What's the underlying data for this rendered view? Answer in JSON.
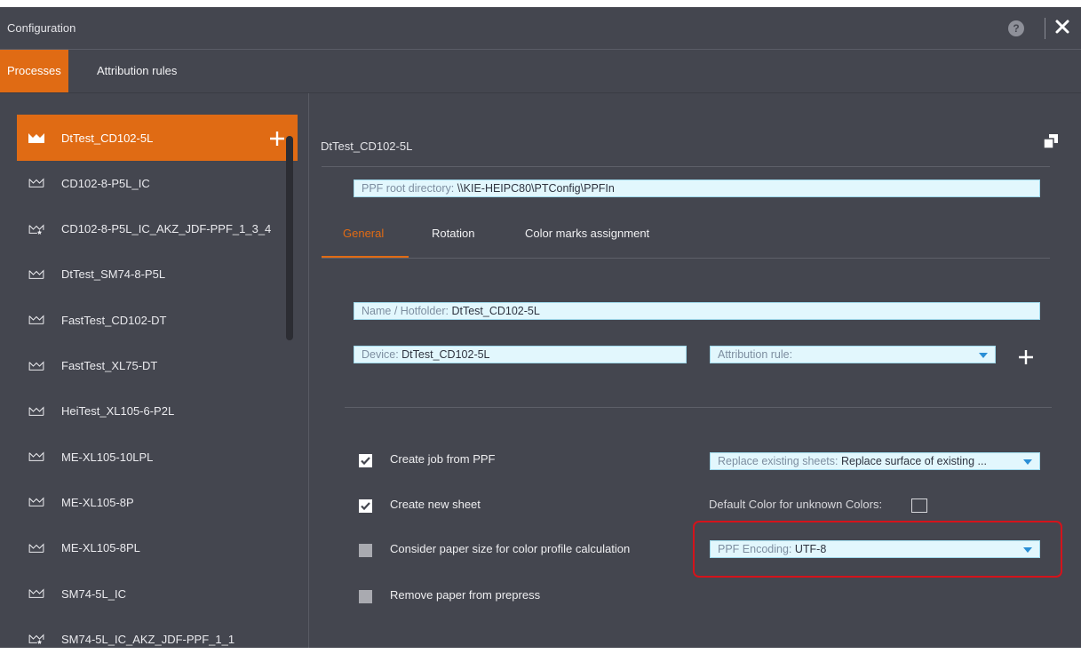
{
  "window": {
    "title": "Configuration"
  },
  "top_tabs": [
    {
      "label": "Processes",
      "active": true
    },
    {
      "label": "Attribution rules",
      "active": false
    }
  ],
  "processes": [
    {
      "label": "DtTest_CD102-5L",
      "active": true,
      "icon": "crown-icon"
    },
    {
      "label": "CD102-8-P5L_IC",
      "icon": "crown-outline-icon"
    },
    {
      "label": "CD102-8-P5L_IC_AKZ_JDF-PPF_1_3_4",
      "icon": "crown-star-icon"
    },
    {
      "label": "DtTest_SM74-8-P5L",
      "icon": "crown-outline-icon"
    },
    {
      "label": "FastTest_CD102-DT",
      "icon": "crown-outline-icon"
    },
    {
      "label": "FastTest_XL75-DT",
      "icon": "crown-outline-icon"
    },
    {
      "label": "HeiTest_XL105-6-P2L",
      "icon": "crown-outline-icon"
    },
    {
      "label": "ME-XL105-10LPL",
      "icon": "crown-outline-icon"
    },
    {
      "label": "ME-XL105-8P",
      "icon": "crown-outline-icon"
    },
    {
      "label": "ME-XL105-8PL",
      "icon": "crown-outline-icon"
    },
    {
      "label": "SM74-5L_IC",
      "icon": "crown-outline-icon"
    },
    {
      "label": "SM74-5L_IC_AKZ_JDF-PPF_1_1",
      "icon": "crown-star-icon"
    }
  ],
  "main": {
    "process_title": "DtTest_CD102-5L",
    "ppf_root": {
      "key": "PPF root directory: ",
      "value": "\\\\KIE-HEIPC80\\PTConfig\\PPFIn"
    },
    "tabs": [
      {
        "label": "General",
        "active": true
      },
      {
        "label": "Rotation"
      },
      {
        "label": "Color marks assignment"
      }
    ],
    "name_field": {
      "key": "Name / Hotfolder: ",
      "value": "DtTest_CD102-5L"
    },
    "device_field": {
      "key": "Device: ",
      "value": "DtTest_CD102-5L"
    },
    "attribution_rule": {
      "key": "Attribution rule: ",
      "value": ""
    },
    "options": [
      {
        "label": "Create job from PPF",
        "checked": true
      },
      {
        "label": "Create new sheet",
        "checked": true
      },
      {
        "label": "Consider paper size for color profile calculation",
        "checked": false
      },
      {
        "label": "Remove paper from prepress",
        "checked": false
      }
    ],
    "replace_sheets": {
      "key": "Replace existing sheets: ",
      "value": "Replace surface of existing ..."
    },
    "default_color_label": "Default Color for unknown Colors:",
    "ppf_encoding": {
      "key": "PPF Encoding: ",
      "value": "UTF-8"
    }
  },
  "colors": {
    "accent": "#e06b14",
    "background": "#44464f",
    "field": "#e2f7fd",
    "highlight": "#d4131b"
  }
}
